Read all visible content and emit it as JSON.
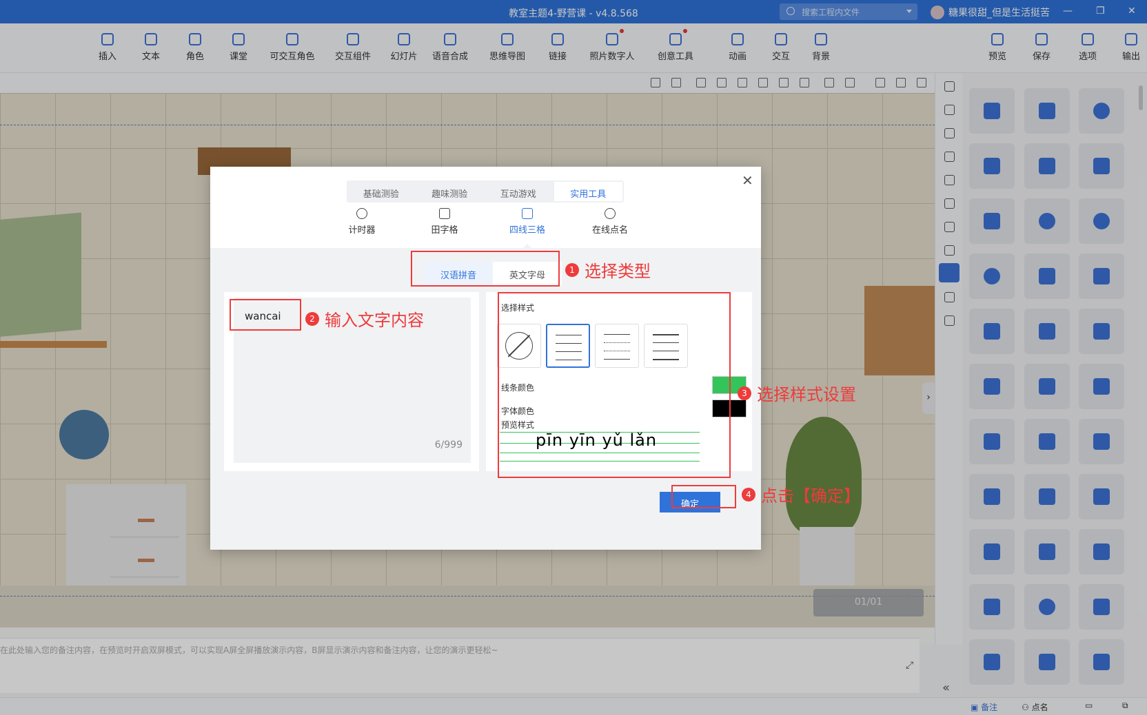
{
  "window": {
    "title": "教室主题4-野营课 - v4.8.568",
    "search_placeholder": "搜索工程内文件",
    "user": "糖果很甜_但是生活挺苦",
    "controls": [
      "—",
      "❐",
      "✕"
    ]
  },
  "toolbar": {
    "items": [
      "插入",
      "文本",
      "角色",
      "课堂",
      "可交互角色",
      "交互组件",
      "幻灯片",
      "语音合成",
      "思维导图",
      "链接",
      "照片数字人",
      "创意工具",
      "动画",
      "交互",
      "背景"
    ],
    "right_items": [
      "预览",
      "保存",
      "选项",
      "输出"
    ]
  },
  "canvas": {
    "slide_counter": "01/01"
  },
  "notes": {
    "placeholder": "在此处输入您的备注内容，在预览时开启双屏模式，可以实现A屏全屏播放演示内容，B屏显示演示内容和备注内容，让您的演示更轻松~"
  },
  "statusbar": {
    "notes_label": "备注",
    "rollcall_label": "点名"
  },
  "dialog": {
    "close": "✕",
    "tabs": [
      "基础测验",
      "趣味测验",
      "互动游戏",
      "实用工具"
    ],
    "tools": [
      "计时器",
      "田字格",
      "四线三格",
      "在线点名"
    ],
    "type_options": [
      "汉语拼音",
      "英文字母"
    ],
    "input_value": "wancai",
    "char_count": "6/999",
    "style_title": "选择样式",
    "line_color_label": "线条颜色",
    "font_color_label": "字体颜色",
    "preview_label": "预览样式",
    "preview_text": "pīn yīn yǔ lǎn",
    "line_color": "#33c45a",
    "font_color": "#000000",
    "confirm": "确定"
  },
  "annotations": [
    {
      "num": "1",
      "text": "选择类型"
    },
    {
      "num": "2",
      "text": "输入文字内容"
    },
    {
      "num": "3",
      "text": "选择样式设置"
    },
    {
      "num": "4",
      "text": "点击【确定】"
    }
  ],
  "colors": {
    "accent": "#2f72d9",
    "annotation": "#ee3b3b"
  }
}
